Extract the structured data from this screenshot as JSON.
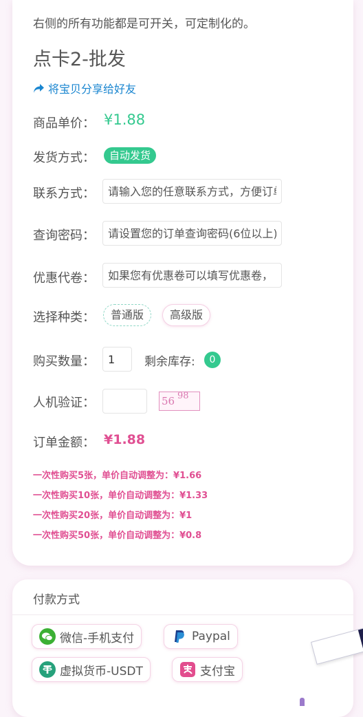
{
  "description": "右侧的所有功能都是可开关，可定制化的。",
  "product": {
    "title": "点卡2-批发",
    "share_label": "将宝贝分享给好友"
  },
  "form": {
    "unit_price_label": "商品单价：",
    "unit_price": "¥1.88",
    "delivery_label": "发货方式：",
    "delivery_badge": "自动发货",
    "contact_label": "联系方式：",
    "contact_placeholder": "请输入您的任意联系方式，方便订单查询",
    "query_pwd_label": "查询密码：",
    "query_pwd_placeholder": "请设置您的订单查询密码(6位以上)",
    "coupon_label": "优惠代卷：",
    "coupon_placeholder": "如果您有优惠卷可以填写优惠卷，",
    "type_label": "选择种类：",
    "type_options": [
      "普通版",
      "高级版"
    ],
    "quantity_label": "购买数量：",
    "quantity_value": "1",
    "stock_label": "剩余库存:",
    "stock_count": "0",
    "captcha_label": "人机验证：",
    "captcha_text": "56",
    "captcha_super": "98",
    "total_label": "订单金额：",
    "total_value": "¥1.88"
  },
  "discounts": [
    "一次性购买5张，单价自动调整为：¥1.66",
    "一次性购买10张，单价自动调整为：¥1.33",
    "一次性购买20张，单价自动调整为：¥1",
    "一次性购买50张，单价自动调整为：¥0.8"
  ],
  "payment": {
    "title": "付款方式",
    "methods": [
      {
        "label": "微信-手机支付",
        "icon": "wechat-icon",
        "color": "#3cb034"
      },
      {
        "label": "Paypal",
        "icon": "paypal-icon",
        "color": "#1a3e8c"
      },
      {
        "label": "虚拟货币-USDT",
        "icon": "usdt-icon",
        "color": "#26a17b"
      },
      {
        "label": "支付宝",
        "icon": "alipay-icon",
        "color": "#e24d8e"
      }
    ]
  },
  "colors": {
    "price_green": "#34c98f",
    "accent_pink": "#e04f92",
    "link_blue": "#1a86d0"
  }
}
